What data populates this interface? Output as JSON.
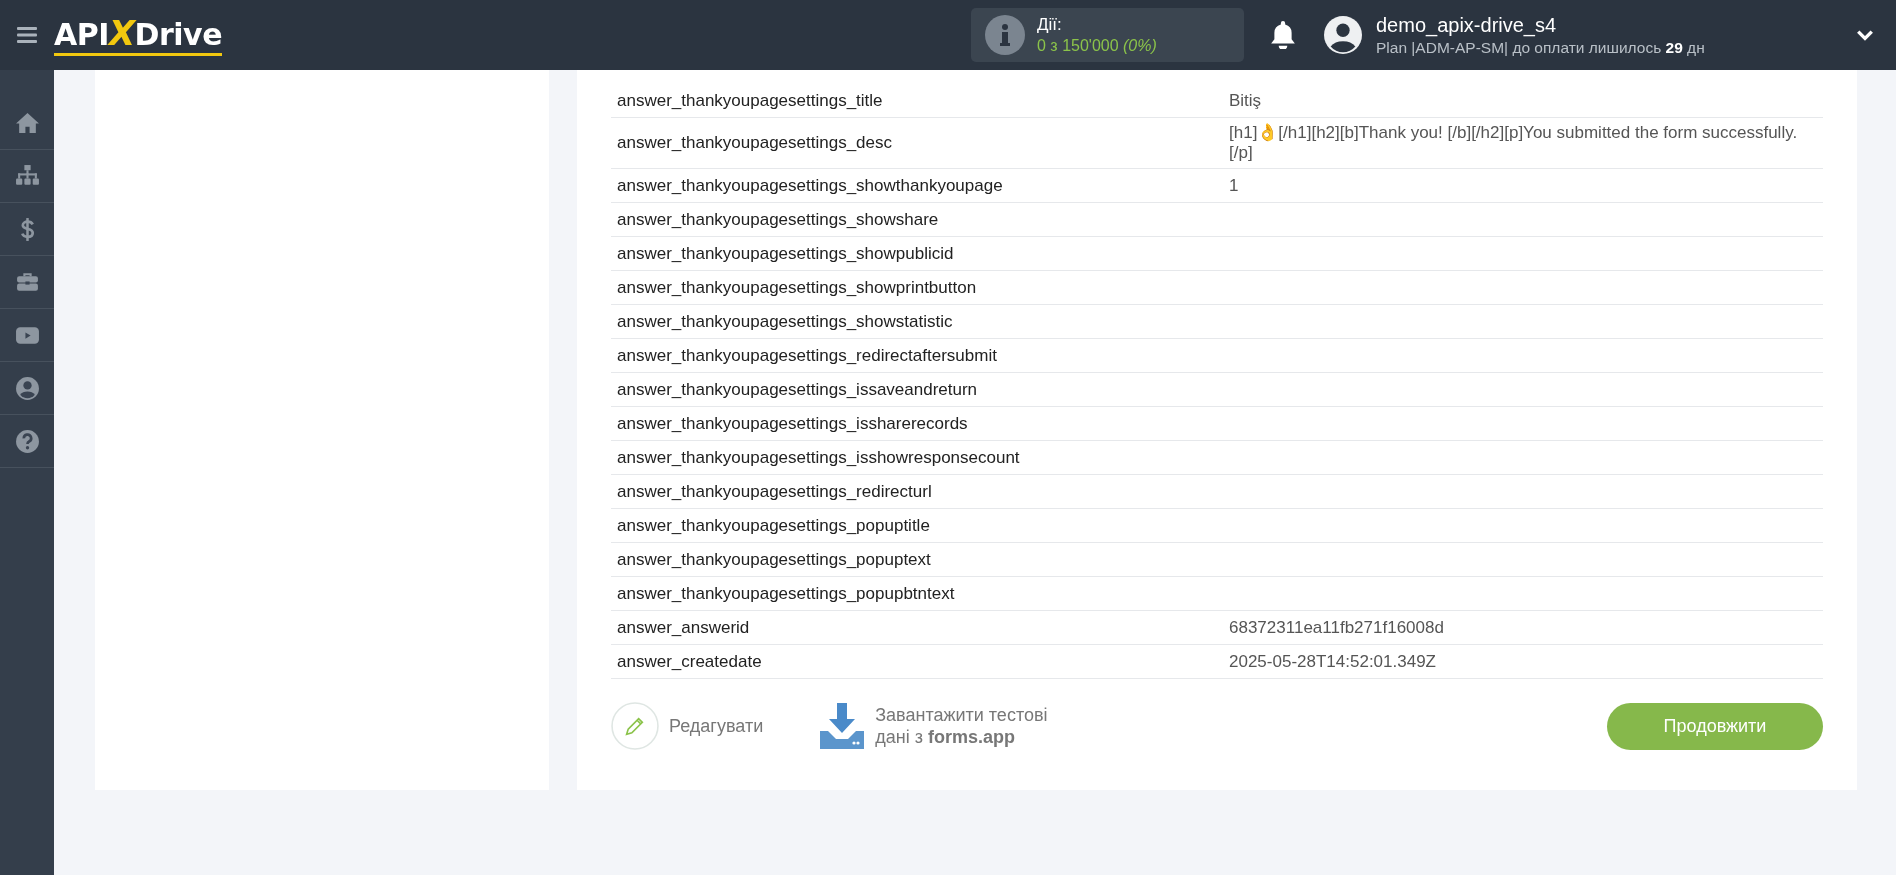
{
  "header": {
    "logo": {
      "part_1": "API",
      "part_2": "X",
      "part_3": "Drive"
    },
    "actions": {
      "label": "Дії:",
      "count": "0 з 150'000",
      "percent": "(0%)"
    },
    "user": {
      "name": "demo_apix-drive_s4",
      "plan": "Plan |ADM-AP-SM| до оплати лишилось ",
      "days": "29",
      "days_unit": " дн"
    }
  },
  "sidebar": {
    "items": [
      {
        "kind": "home",
        "selected": false
      },
      {
        "kind": "sitemap",
        "selected": false
      },
      {
        "kind": "dollar",
        "selected": false
      },
      {
        "kind": "briefcase",
        "selected": false
      },
      {
        "kind": "video",
        "selected": false
      },
      {
        "kind": "user",
        "selected": false
      },
      {
        "kind": "help",
        "selected": false
      }
    ]
  },
  "table": {
    "rows": [
      {
        "field": "answer_thankyoupagesettings_title",
        "value": "Bitiş"
      },
      {
        "field": "answer_thankyoupagesettings_desc",
        "value": "[h1]👌[/h1][h2][b]Thank you! [/b][/h2][p]You submitted the form successfully.[/p]"
      },
      {
        "field": "answer_thankyoupagesettings_showthankyoupage",
        "value": "1"
      },
      {
        "field": "answer_thankyoupagesettings_showshare",
        "value": ""
      },
      {
        "field": "answer_thankyoupagesettings_showpublicid",
        "value": ""
      },
      {
        "field": "answer_thankyoupagesettings_showprintbutton",
        "value": ""
      },
      {
        "field": "answer_thankyoupagesettings_showstatistic",
        "value": ""
      },
      {
        "field": "answer_thankyoupagesettings_redirectaftersubmit",
        "value": ""
      },
      {
        "field": "answer_thankyoupagesettings_issaveandreturn",
        "value": ""
      },
      {
        "field": "answer_thankyoupagesettings_issharerecords",
        "value": ""
      },
      {
        "field": "answer_thankyoupagesettings_isshowresponsecount",
        "value": ""
      },
      {
        "field": "answer_thankyoupagesettings_redirecturl",
        "value": ""
      },
      {
        "field": "answer_thankyoupagesettings_popuptitle",
        "value": ""
      },
      {
        "field": "answer_thankyoupagesettings_popuptext",
        "value": ""
      },
      {
        "field": "answer_thankyoupagesettings_popupbtntext",
        "value": ""
      },
      {
        "field": "answer_answerid",
        "value": "68372311ea11fb271f16008d"
      },
      {
        "field": "answer_createdate",
        "value": "2025-05-28T14:52:01.349Z"
      }
    ]
  },
  "actions": {
    "edit": "Редагувати",
    "download": "Завантажити тестові дані з **forms.app**",
    "continue": "Продовжити"
  }
}
